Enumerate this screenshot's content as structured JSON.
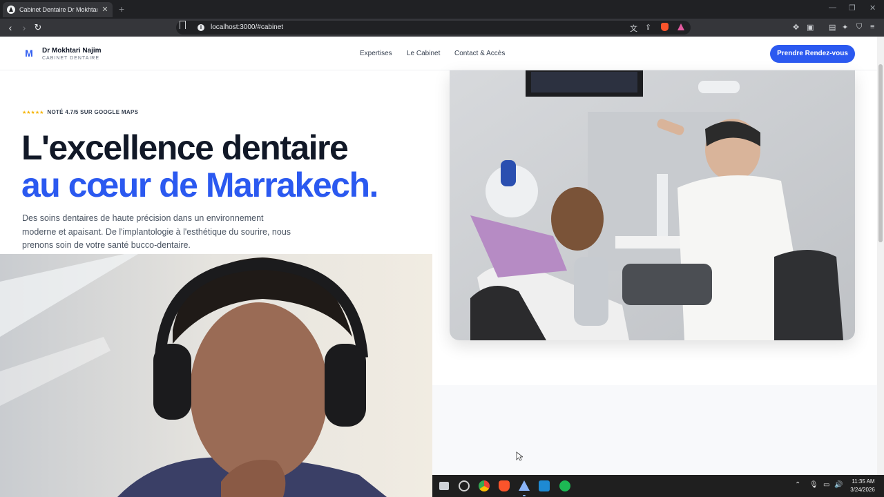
{
  "browser": {
    "tab_title": "Cabinet Dentaire Dr Mokhtari N",
    "tab_close": "✕",
    "new_tab": "+",
    "url": "localhost:3000/#cabinet"
  },
  "header": {
    "logo_letter": "M",
    "brand_name": "Dr Mokhtari Najim",
    "brand_sub": "CABINET DENTAIRE",
    "nav": [
      "Expertises",
      "Le Cabinet",
      "Contact & Accès"
    ],
    "cta_label": "Prendre Rendez-vous"
  },
  "hero": {
    "stars": "★★★★★",
    "rating_text": "NOTÉ 4.7/5 SUR GOOGLE MAPS",
    "title_line1": "L'excellence dentaire",
    "title_line2": "au cœur de Marrakech.",
    "lead": "Des soins dentaires de haute précision dans un environnement moderne et apaisant. De l'implantologie à l'esthétique du sourire, nous prenons soin de votre santé bucco-dentaire."
  },
  "taskbar": {
    "time": "11:35 AM",
    "date": "3/24/2026"
  },
  "colors": {
    "accent": "#2b59f0",
    "heading": "#111827",
    "star": "#f5b400"
  }
}
